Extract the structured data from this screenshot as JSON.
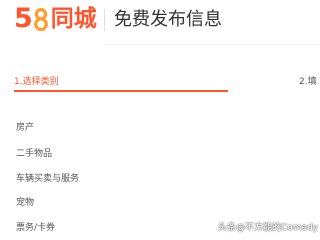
{
  "header": {
    "logo_number": "5",
    "logo_city": "同城",
    "title": "免费发布信息"
  },
  "steps": {
    "step1_label": "1.选择类别",
    "step2_label": "2.填"
  },
  "categories": [
    {
      "label": "房产"
    },
    {
      "label": "二手物品"
    },
    {
      "label": "车辆买卖与服务"
    },
    {
      "label": "宠物"
    },
    {
      "label": "票务/卡券"
    }
  ],
  "watermark": {
    "text": "头条@不方能的Comedy"
  },
  "colors": {
    "brand": "#ff552e",
    "logo_eight": "#ff9e2c"
  }
}
